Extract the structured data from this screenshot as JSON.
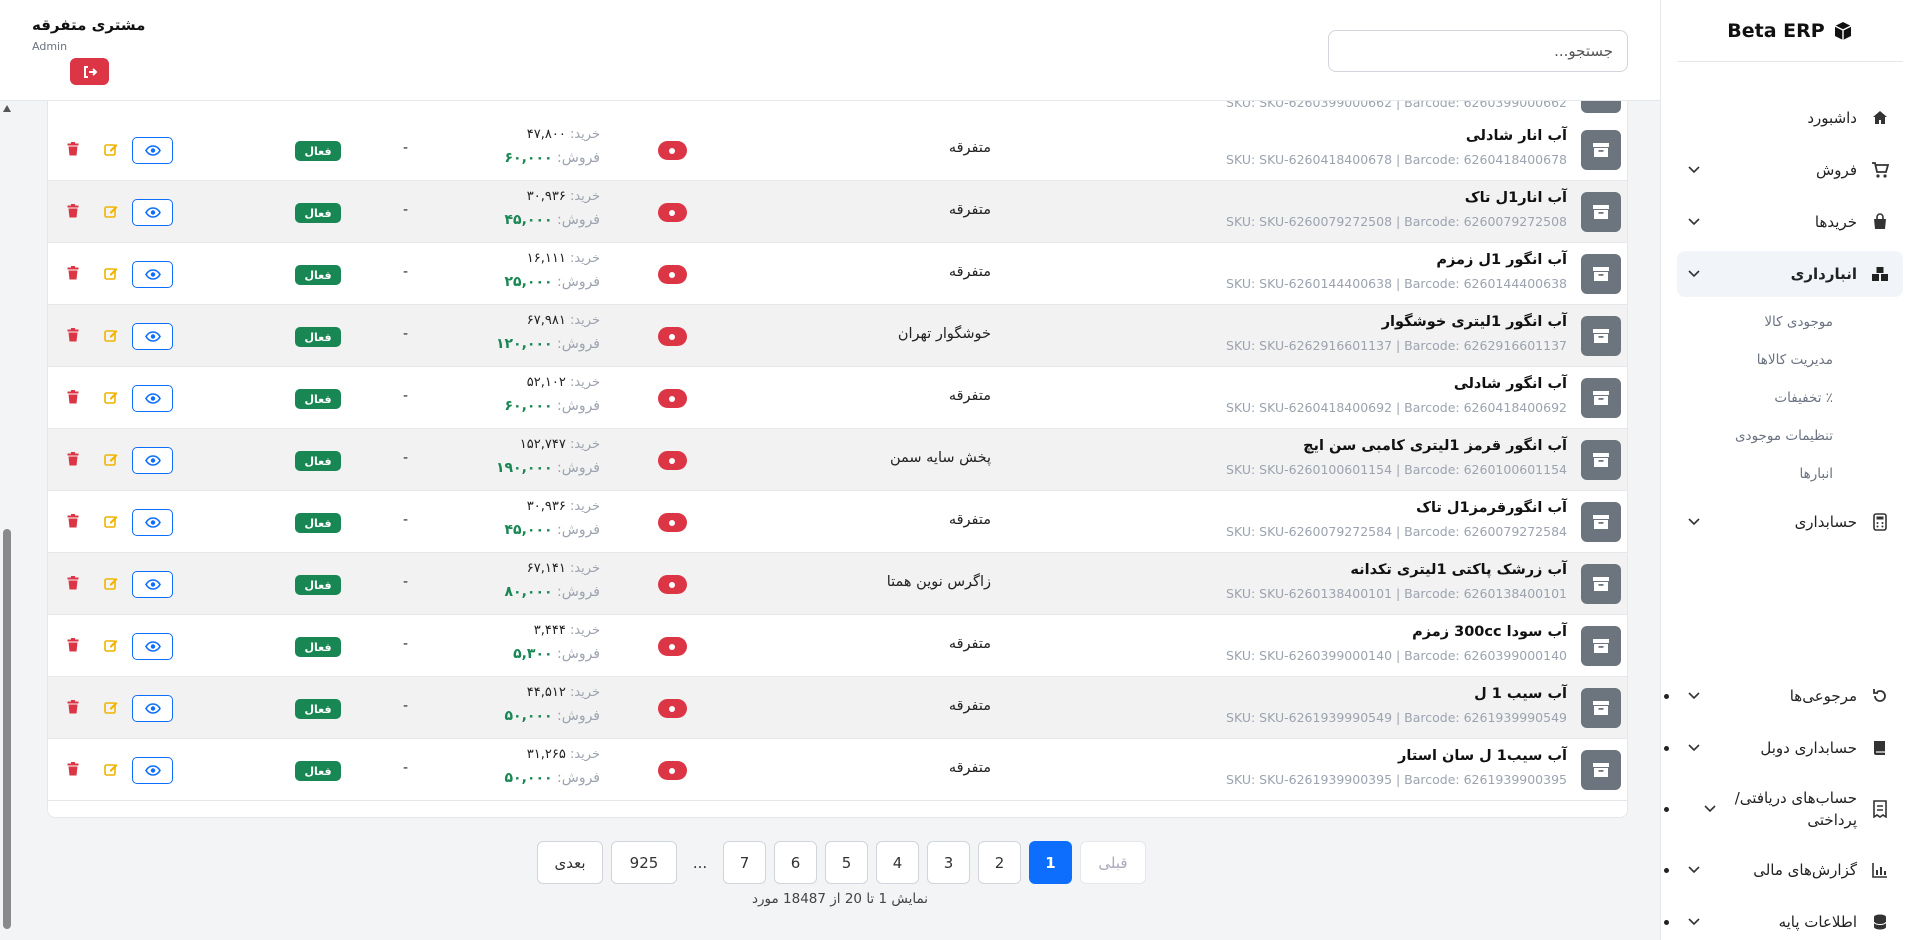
{
  "app": {
    "brand": "Beta ERP"
  },
  "header": {
    "search_placeholder": "جستجو...",
    "user_name": "مشتری متفرقه",
    "user_role": "Admin"
  },
  "sidebar": {
    "items": [
      {
        "label": "داشبورد",
        "icon": "home-icon",
        "chevron": false
      },
      {
        "label": "فروش",
        "icon": "cart-icon",
        "chevron": true
      },
      {
        "label": "خریدها",
        "icon": "bag-icon",
        "chevron": true
      },
      {
        "label": "انبارداری",
        "icon": "boxes-icon",
        "chevron": true,
        "active": true
      },
      {
        "label": "حسابداری",
        "icon": "calculator-icon",
        "chevron": true
      },
      {
        "label": "مرجوعی‌ها",
        "icon": "return-icon",
        "chevron": true
      },
      {
        "label": "حسابداری دوبل",
        "icon": "book-icon",
        "chevron": true
      },
      {
        "label": "حساب‌های دریافتی/پرداختی",
        "icon": "receipt-icon",
        "chevron": true
      },
      {
        "label": "گزارش‌های مالی",
        "icon": "chart-icon",
        "chevron": true
      },
      {
        "label": "اطلاعات پایه",
        "icon": "database-icon",
        "chevron": true
      }
    ],
    "submenu": [
      "موجودی کالا",
      "مدیریت کالاها",
      "٪ تخفیفات",
      "تنظیمات موجودی",
      "انبارها"
    ]
  },
  "table": {
    "buy_label": "خرید:",
    "sell_label": "فروش:",
    "status_label": "فعال",
    "dash": "-",
    "partial_sku": "SKU: SKU-6260399000662 | Barcode: 6260399000662",
    "rows": [
      {
        "name": "آب انار شادلی",
        "sku": "SKU: SKU-6260418400678 | Barcode: 6260418400678",
        "supplier": "متفرقه",
        "buy": "۴۷,۸۰۰",
        "sell": "۶۰,۰۰۰"
      },
      {
        "name": "آب انار1ل تاک",
        "sku": "SKU: SKU-6260079272508 | Barcode: 6260079272508",
        "supplier": "متفرقه",
        "buy": "۳۰,۹۳۶",
        "sell": "۴۵,۰۰۰"
      },
      {
        "name": "آب انگور 1ل زمزم",
        "sku": "SKU: SKU-6260144400638 | Barcode: 6260144400638",
        "supplier": "متفرقه",
        "buy": "۱۶,۱۱۱",
        "sell": "۲۵,۰۰۰"
      },
      {
        "name": "آب انگور 1لیتری خوشگوار",
        "sku": "SKU: SKU-6262916601137 | Barcode: 6262916601137",
        "supplier": "خوشگوار تهران",
        "buy": "۶۷,۹۸۱",
        "sell": "۱۲۰,۰۰۰"
      },
      {
        "name": "آب انگور شادلی",
        "sku": "SKU: SKU-6260418400692 | Barcode: 6260418400692",
        "supplier": "متفرقه",
        "buy": "۵۲,۱۰۲",
        "sell": "۶۰,۰۰۰"
      },
      {
        "name": "آب انگور قرمز 1لیتری کامبی سن ایچ",
        "sku": "SKU: SKU-6260100601154 | Barcode: 6260100601154",
        "supplier": "پخش سایه سمن",
        "buy": "۱۵۲,۷۴۷",
        "sell": "۱۹۰,۰۰۰"
      },
      {
        "name": "آب انگورقرمز1ل تاک",
        "sku": "SKU: SKU-6260079272584 | Barcode: 6260079272584",
        "supplier": "متفرقه",
        "buy": "۳۰,۹۳۶",
        "sell": "۴۵,۰۰۰"
      },
      {
        "name": "آب زرشک پاکتی 1لیتری تکدانه",
        "sku": "SKU: SKU-6260138400101 | Barcode: 6260138400101",
        "supplier": "زاگرس نوین همتا",
        "buy": "۶۷,۱۴۱",
        "sell": "۸۰,۰۰۰"
      },
      {
        "name": "آب سودا 300cc زمزم",
        "sku": "SKU: SKU-6260399000140 | Barcode: 6260399000140",
        "supplier": "متفرقه",
        "buy": "۳,۴۴۴",
        "sell": "۵,۳۰۰"
      },
      {
        "name": "آب سیب 1 ل",
        "sku": "SKU: SKU-6261939990549 | Barcode: 6261939990549",
        "supplier": "متفرقه",
        "buy": "۴۴,۵۱۲",
        "sell": "۵۰,۰۰۰"
      },
      {
        "name": "آب سیب1 ل سان استار",
        "sku": "SKU: SKU-6261939900395 | Barcode: 6261939900395",
        "supplier": "متفرقه",
        "buy": "۳۱,۲۶۵",
        "sell": "۵۰,۰۰۰"
      }
    ]
  },
  "pagination": {
    "prev": "قبلی",
    "next": "بعدی",
    "pages": [
      "1",
      "2",
      "3",
      "4",
      "5",
      "6",
      "7"
    ],
    "ellipsis": "...",
    "last": "925",
    "info": "نمایش 1 تا 20 از 18487 مورد"
  },
  "colors": {
    "primary": "#0d6efd",
    "danger": "#dc3545",
    "success": "#198754",
    "warning": "#f0b400"
  }
}
